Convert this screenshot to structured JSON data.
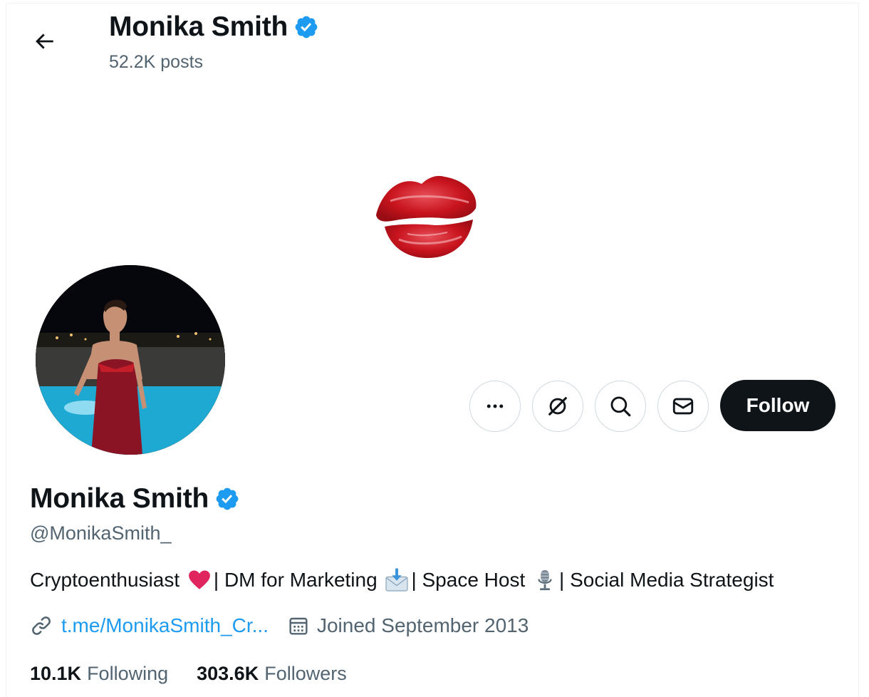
{
  "header": {
    "name": "Monika Smith",
    "posts": "52.2K posts"
  },
  "actions": {
    "follow_label": "Follow"
  },
  "profile": {
    "name": "Monika Smith",
    "handle": "@MonikaSmith_",
    "bio": {
      "part1": "Cryptoenthusiast ",
      "part2": "| DM for Marketing ",
      "part3": "| Space Host ",
      "part4": "| Social Media Strategist"
    },
    "link": "t.me/MonikaSmith_Cr...",
    "joined": "Joined September 2013",
    "following_count": "10.1K",
    "following_label": "Following",
    "followers_count": "303.6K",
    "followers_label": "Followers"
  },
  "icons": {
    "back": "arrow-left-icon",
    "verified": "verified-badge-icon",
    "more": "more-icon",
    "grok": "grok-icon",
    "search": "search-icon",
    "message": "envelope-icon",
    "link": "link-icon",
    "calendar": "calendar-icon"
  },
  "colors": {
    "accent": "#1d9bf0",
    "verified": "#1d9bf0",
    "follow_bg": "#0f1419",
    "secondary_text": "#536471"
  }
}
